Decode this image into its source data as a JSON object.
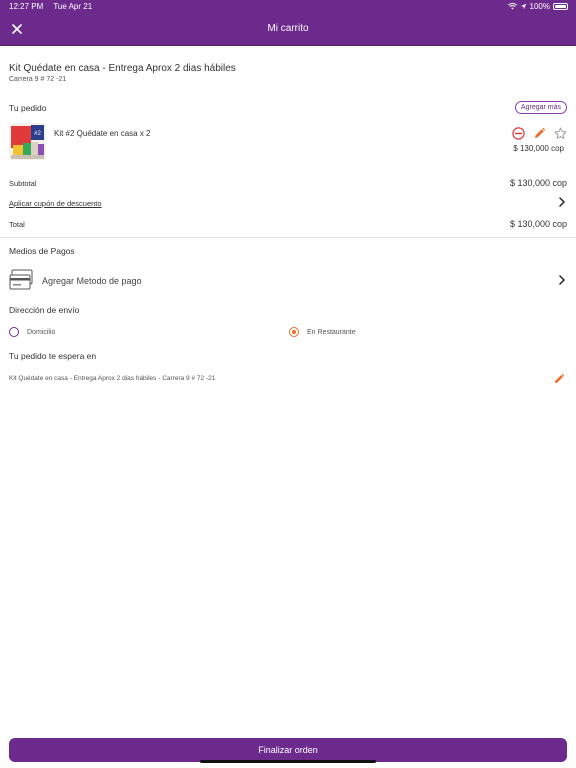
{
  "status_bar": {
    "time": "12:27 PM",
    "date": "Tue Apr 21",
    "battery": "100%",
    "icons": [
      "wifi-icon",
      "location-icon",
      "battery-icon"
    ]
  },
  "nav": {
    "title": "Mi carrito",
    "close_icon": "close-icon"
  },
  "kit": {
    "title": "Kit Quédate en casa - Entrega Aprox 2 dias hábiles",
    "address": "Carrera 9 # 72 -21"
  },
  "order": {
    "heading": "Tu pedido",
    "add_more": "Agregar más",
    "items": [
      {
        "name": "Kit #2 Quédate en casa x 2",
        "price": "$ 130,000 cop",
        "icons": [
          "remove-icon",
          "edit-icon",
          "favorite-star-icon"
        ]
      }
    ],
    "subtotal_label": "Subtotal",
    "subtotal_value": "$ 130,000 cop",
    "coupon_label": "Aplicar cupón de descuento",
    "total_label": "Total",
    "total_value": "$ 130,000 cop"
  },
  "payments": {
    "heading": "Medios de Pagos",
    "add_method": "Agregar Metodo de pago"
  },
  "shipping": {
    "heading": "Dirección de envío",
    "options": [
      {
        "label": "Domicilio",
        "selected": false
      },
      {
        "label": "En Restaurante",
        "selected": true
      }
    ]
  },
  "pickup": {
    "heading": "Tu pedido te espera en",
    "info": "Kit Quédate en casa - Entrega Aprox 2 dias hábiles - Carrera 9 # 72 -21"
  },
  "footer": {
    "finalize": "Finalizar orden"
  },
  "colors": {
    "primary": "#6b2a8c",
    "accent": "#ef6a2b",
    "remove": "#e23c3c"
  }
}
